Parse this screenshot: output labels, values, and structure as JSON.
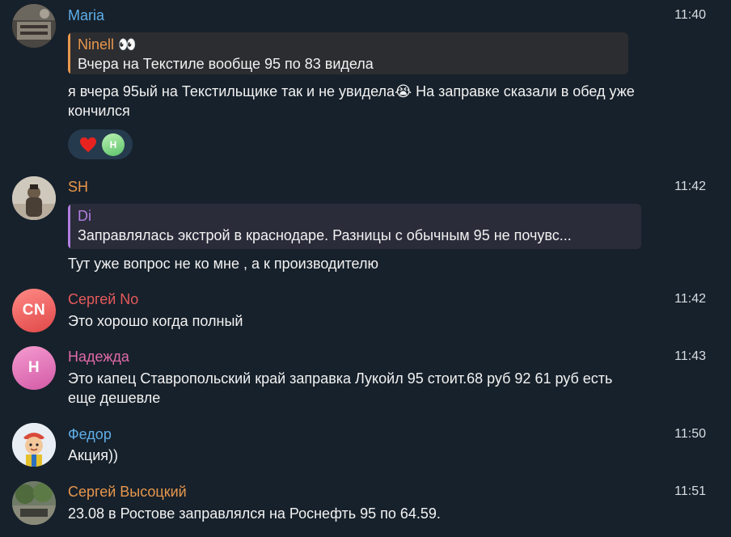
{
  "messages": [
    {
      "name": "Maria",
      "time": "11:40",
      "reply": {
        "name": "Ninell 👀",
        "text": "Вчера на Текстиле  вообще 95 по 83 видела"
      },
      "text": "я вчера 95ый на Текстильщике так и не увидела😭 На заправке сказали в обед уже кончился",
      "reactions": {
        "emoji": "heart-icon",
        "user_initial": "Н"
      }
    },
    {
      "name": "SH",
      "time": "11:42",
      "reply": {
        "name": "Di",
        "text": "Заправлялась экстрой в краснодаре. Разницы с обычным 95 не почувс..."
      },
      "text": "Тут уже вопрос не ко мне , а к производителю"
    },
    {
      "name": "Сергей No",
      "time": "11:42",
      "avatar_initials": "CN",
      "text": "Это хорошо когда полный"
    },
    {
      "name": "Надежда",
      "time": "11:43",
      "avatar_initials": "Н",
      "text": "Это капец Ставропольский край заправка Лукойл 95 стоит.68 руб 92 61 руб есть еще дешевле"
    },
    {
      "name": "Федор",
      "time": "11:50",
      "text": "Акция))"
    },
    {
      "name": "Сергей Высоцкий",
      "time": "11:51",
      "text": "23.08 в Ростове заправлялся на Роснефть 95 по 64.59."
    }
  ],
  "colors": {
    "background": "#17212b",
    "maria": "#5eaee8",
    "sh": "#e8974d",
    "sergey_no": "#e55a5a",
    "nadezhda": "#e06aa8",
    "fedor": "#5eaee8",
    "sergey_v": "#e8974d",
    "reply_ninell": "#e8974d",
    "reply_di": "#b07fe0"
  }
}
